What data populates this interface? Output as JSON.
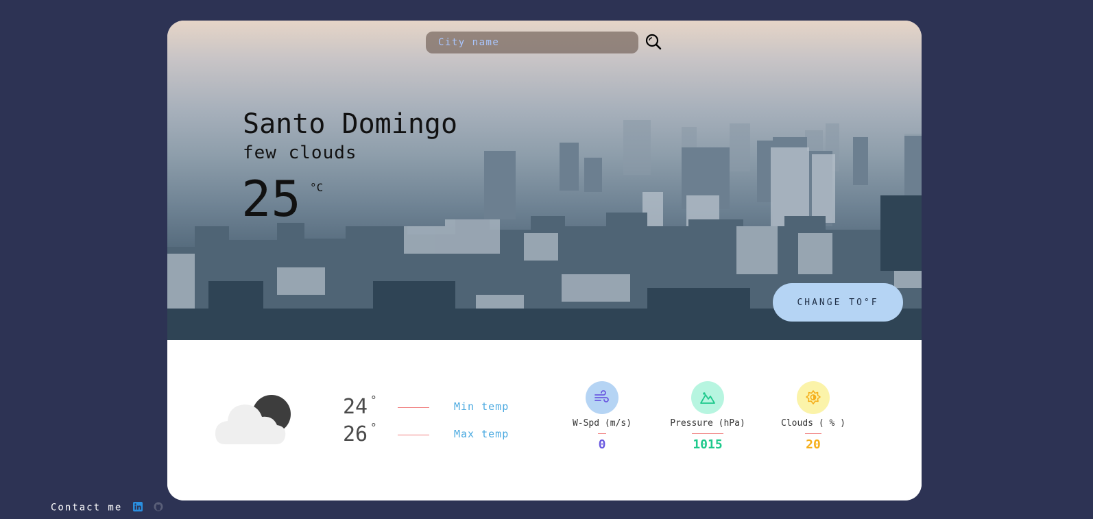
{
  "search": {
    "placeholder": "City name",
    "value": ""
  },
  "current": {
    "city": "Santo Domingo",
    "description": "few clouds",
    "temperature": "25",
    "unit": "°C"
  },
  "unit_toggle": {
    "label": "CHANGE TO°F"
  },
  "min_max": {
    "min": {
      "value": "24",
      "degree": "°",
      "label": "Min temp"
    },
    "max": {
      "value": "26",
      "degree": "°",
      "label": "Max temp"
    }
  },
  "stats": {
    "wind": {
      "label": "W-Spd (m/s)",
      "value": "0",
      "color": "#6a5ae0",
      "bg": "#b5d4f4",
      "icon": "wind-icon"
    },
    "pressure": {
      "label": "Pressure (hPa)",
      "value": "1015",
      "color": "#1ec98c",
      "bg": "#b7f5e0",
      "icon": "mountain-icon"
    },
    "clouds": {
      "label": "Clouds ( % )",
      "value": "20",
      "color": "#f5ae1a",
      "bg": "#fbf3a9",
      "icon": "sun-icon"
    }
  },
  "footer": {
    "contact_label": "Contact me",
    "linkedin_icon": "linkedin-icon",
    "github_icon": "github-icon"
  },
  "colors": {
    "page_bg": "#2d3354",
    "card_bg": "#ffffff",
    "button_bg": "#b5d4f4",
    "accent_line": "#f07c7c",
    "label_blue": "#4aa9e0"
  }
}
